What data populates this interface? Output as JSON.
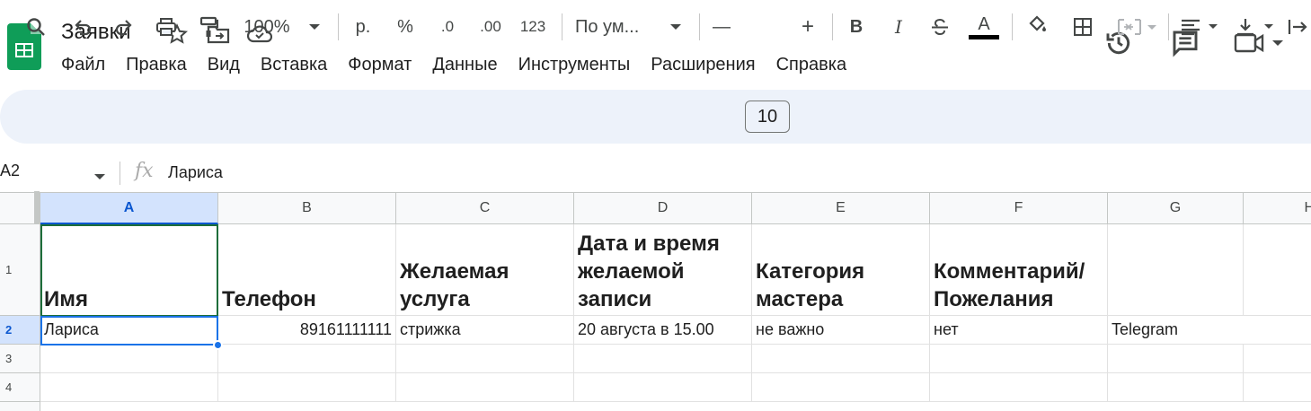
{
  "doc": {
    "title": "Заявки"
  },
  "menu": [
    "Файл",
    "Правка",
    "Вид",
    "Вставка",
    "Формат",
    "Данные",
    "Инструменты",
    "Расширения",
    "Справка"
  ],
  "toolbar": {
    "zoom": "100%",
    "currency": "р.",
    "percent": "%",
    "decrease_decimal": ".0",
    "increase_decimal": ".00",
    "number_format": "123",
    "font": "По ум...",
    "font_size": "10",
    "minus": "—",
    "plus": "+",
    "bold": "B",
    "italic": "I",
    "text_color": "A"
  },
  "formula_bar": {
    "cell_ref": "A2",
    "fx": "fx",
    "value": "Лариса"
  },
  "columns": [
    "A",
    "B",
    "C",
    "D",
    "E",
    "F",
    "G",
    "H"
  ],
  "rows": [
    "1",
    "2",
    "3",
    "4"
  ],
  "header_row": [
    "Имя",
    "Телефон",
    "Желаемая услуга",
    "Дата и время желаемой записи",
    "Категория мастера",
    "Комментарий/ Пожелания",
    ""
  ],
  "data_rows": [
    [
      "Лариса",
      "89161111111",
      "стрижка",
      "20 августа в 15.00",
      "не важно",
      "нет",
      "Telegram"
    ]
  ],
  "colors": {
    "accent": "#1a73e8",
    "sheets_green": "#0f9d58",
    "selected_header": "#d3e3fd"
  }
}
